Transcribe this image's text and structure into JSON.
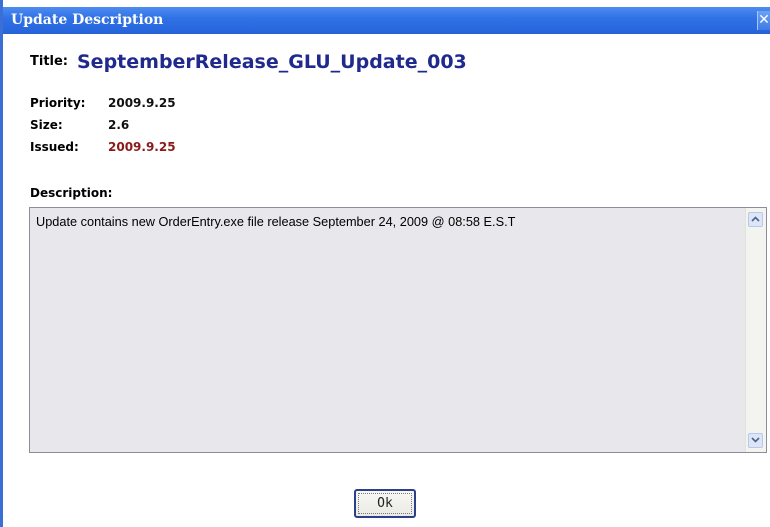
{
  "window": {
    "title": "Update Description",
    "close_icon": "close-icon"
  },
  "update": {
    "title_label": "Title:",
    "title_value": "SeptemberRelease_GLU_Update_003",
    "fields": [
      {
        "label": "Priority:",
        "value": "2009.9.25"
      },
      {
        "label": "Size:",
        "value": "2.6"
      },
      {
        "label": "Issued:",
        "value": "2009.9.25"
      }
    ],
    "issued_color": "#8b1a1a",
    "title_color": "#1f2a8c"
  },
  "description": {
    "label": "Description:",
    "text": "Update contains new OrderEntry.exe file release September 24, 2009 @ 08:58 E.S.T"
  },
  "actions": {
    "ok_label": "Ok"
  }
}
